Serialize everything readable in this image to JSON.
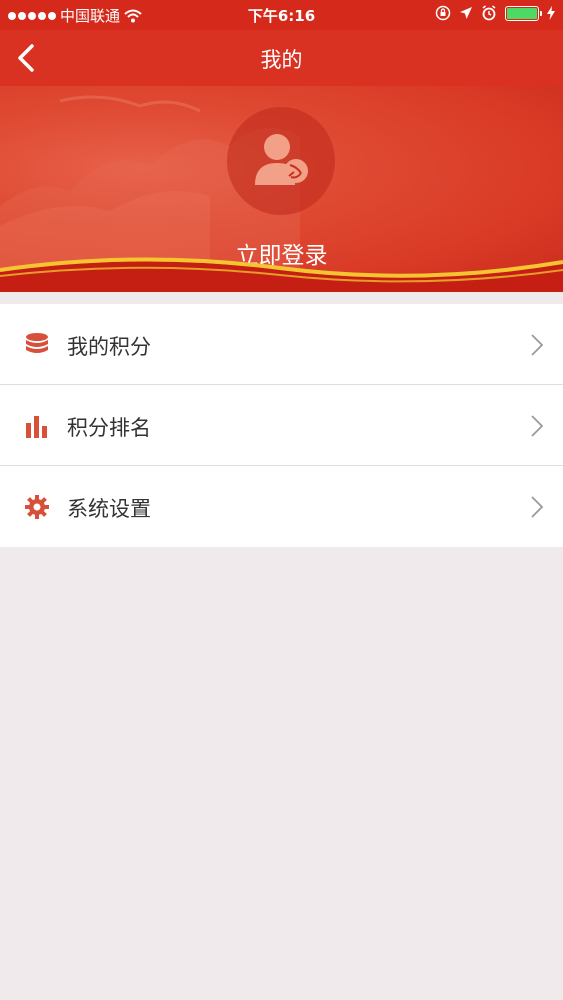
{
  "status_bar": {
    "carrier": "中国联通",
    "time": "下午6:16",
    "battery_level": 1.0
  },
  "nav": {
    "title": "我的"
  },
  "profile": {
    "login_label": "立即登录"
  },
  "menu": {
    "items": [
      {
        "label": "我的积分",
        "icon": "database-icon"
      },
      {
        "label": "积分排名",
        "icon": "bar-chart-icon"
      },
      {
        "label": "系统设置",
        "icon": "gear-icon"
      }
    ]
  },
  "colors": {
    "primary": "#d93222",
    "icon_accent": "#d9503a",
    "background": "#f1eaec"
  }
}
